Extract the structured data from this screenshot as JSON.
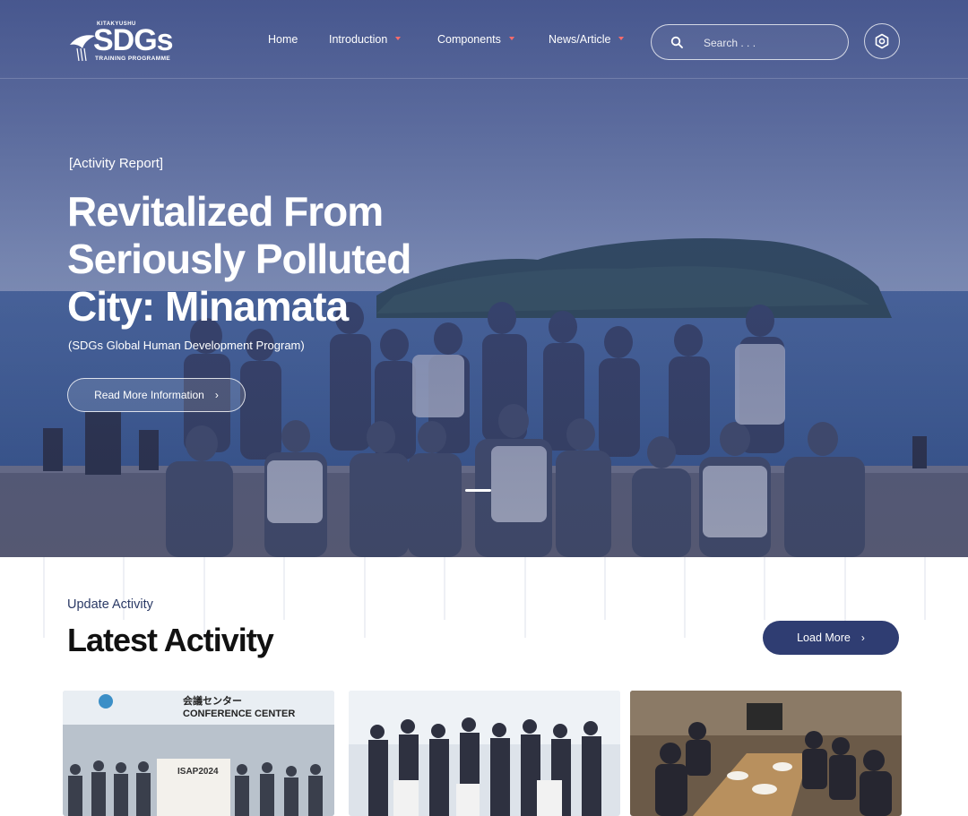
{
  "header": {
    "logo": {
      "top_text": "KITAKYUSHU",
      "main_text": "SDGs",
      "sub_text": "TRAINING PROGRAMME"
    },
    "nav": [
      {
        "label": "Home",
        "has_dropdown": false
      },
      {
        "label": "Introduction",
        "has_dropdown": true
      },
      {
        "label": "Components",
        "has_dropdown": true
      },
      {
        "label": "News/Article",
        "has_dropdown": true
      }
    ],
    "search": {
      "placeholder": "Search . . ."
    },
    "settings_icon": "hexagon-gear-icon"
  },
  "hero": {
    "eyebrow": "[Activity Report]",
    "title": "Revitalized From Seriously Polluted City: Minamata",
    "subtitle": "(SDGs Global Human Development Program)",
    "cta_label": "Read More Information",
    "active_slide": 1
  },
  "latest": {
    "eyebrow": "Update Activity",
    "title": "Latest Activity",
    "load_more_label": "Load More",
    "cards": [
      {
        "sign_top": "会議センター",
        "sign_main": "CONFERENCE CENTER",
        "banner": "ISAP2024"
      },
      {
        "banner": ""
      },
      {
        "banner": ""
      }
    ]
  },
  "colors": {
    "hero_overlay": "#2c3a78",
    "accent_caret": "#ff6b6b",
    "button_navy": "#2f3d72",
    "eyebrow_text": "#2b3a66"
  }
}
